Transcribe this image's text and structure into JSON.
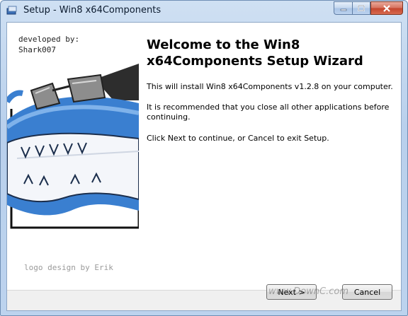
{
  "window": {
    "title": "Setup - Win8 x64Components",
    "accent": "#b9d0ec",
    "close_button_color": "#c3442c"
  },
  "side_panel": {
    "developer_text": "developed by:\nShark007",
    "logo_credit": "logo design by Erik",
    "mascot_icon": "shark-with-sunglasses-logo"
  },
  "main": {
    "heading": "Welcome to the Win8 x64Components Setup Wizard",
    "paragraph_1": "This will install Win8 x64Components v1.2.8 on your computer.",
    "paragraph_2": "It is recommended that you close all other applications before continuing.",
    "paragraph_3": "Click Next to continue, or Cancel to exit Setup."
  },
  "footer": {
    "next_label": "Next >",
    "cancel_label": "Cancel",
    "watermark": "www.DownC.com"
  }
}
